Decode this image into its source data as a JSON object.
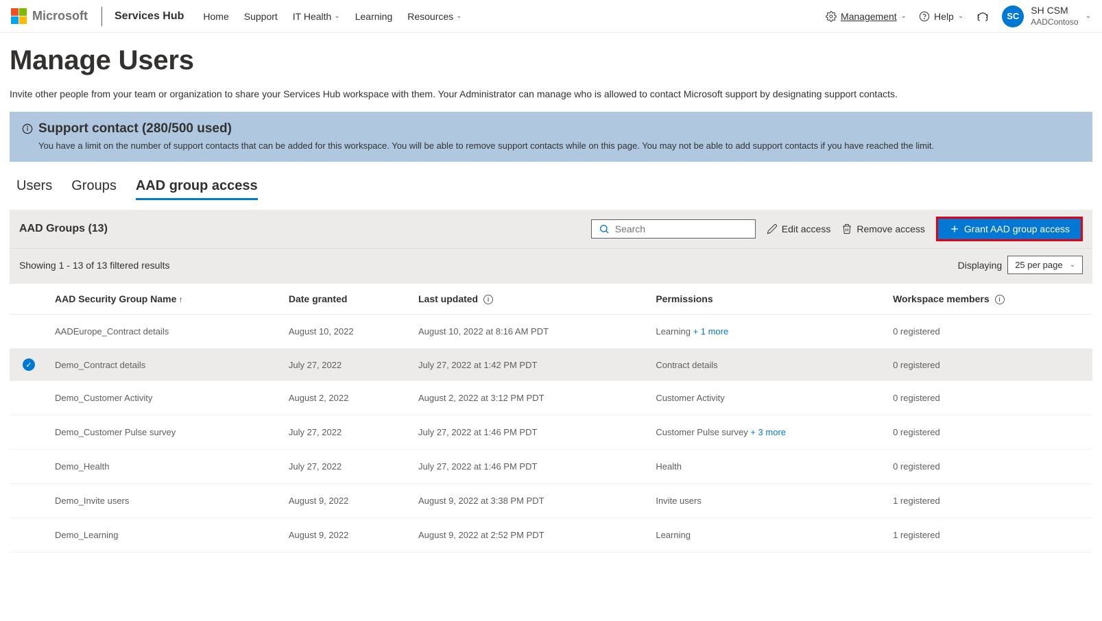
{
  "header": {
    "brand": "Microsoft",
    "app": "Services Hub",
    "nav": {
      "home": "Home",
      "support": "Support",
      "ithealth": "IT Health",
      "learning": "Learning",
      "resources": "Resources"
    },
    "right": {
      "management": "Management",
      "help": "Help"
    },
    "user": {
      "initials": "SC",
      "name": "SH CSM",
      "org": "AADContoso"
    }
  },
  "page": {
    "title": "Manage Users",
    "description": "Invite other people from your team or organization to share your Services Hub workspace with them. Your Administrator can manage who is allowed to contact Microsoft support by designating support contacts."
  },
  "notice": {
    "title": "Support contact (280/500 used)",
    "body": "You have a limit on the number of support contacts that can be added for this workspace. You will be able to remove support contacts while on this page. You may not be able to add support contacts if you have reached the limit."
  },
  "tabs": {
    "users": "Users",
    "groups": "Groups",
    "aad": "AAD group access"
  },
  "toolbar": {
    "title": "AAD Groups (13)",
    "search_placeholder": "Search",
    "edit_access": "Edit access",
    "remove_access": "Remove access",
    "grant_button": "Grant AAD group access"
  },
  "subtoolbar": {
    "showing": "Showing 1 - 13 of 13 filtered results",
    "displaying": "Displaying",
    "page_size": "25 per page"
  },
  "columns": {
    "name": "AAD Security Group Name",
    "date_granted": "Date granted",
    "last_updated": "Last updated",
    "permissions": "Permissions",
    "members": "Workspace members"
  },
  "rows": [
    {
      "selected": false,
      "name": "AADEurope_Contract details",
      "date_granted": "August 10, 2022",
      "last_updated": "August 10, 2022 at 8:16 AM PDT",
      "permissions": "Learning",
      "more": "+ 1 more",
      "members": "0 registered"
    },
    {
      "selected": true,
      "name": "Demo_Contract details",
      "date_granted": "July 27, 2022",
      "last_updated": "July 27, 2022 at 1:42 PM PDT",
      "permissions": "Contract details",
      "more": "",
      "members": "0 registered"
    },
    {
      "selected": false,
      "name": "Demo_Customer Activity",
      "date_granted": "August 2, 2022",
      "last_updated": "August 2, 2022 at 3:12 PM PDT",
      "permissions": "Customer Activity",
      "more": "",
      "members": "0 registered"
    },
    {
      "selected": false,
      "name": "Demo_Customer Pulse survey",
      "date_granted": "July 27, 2022",
      "last_updated": "July 27, 2022 at 1:46 PM PDT",
      "permissions": "Customer Pulse survey",
      "more": "+ 3 more",
      "members": "0 registered"
    },
    {
      "selected": false,
      "name": "Demo_Health",
      "date_granted": "July 27, 2022",
      "last_updated": "July 27, 2022 at 1:46 PM PDT",
      "permissions": "Health",
      "more": "",
      "members": "0 registered"
    },
    {
      "selected": false,
      "name": "Demo_Invite users",
      "date_granted": "August 9, 2022",
      "last_updated": "August 9, 2022 at 3:38 PM PDT",
      "permissions": "Invite users",
      "more": "",
      "members": "1 registered"
    },
    {
      "selected": false,
      "name": "Demo_Learning",
      "date_granted": "August 9, 2022",
      "last_updated": "August 9, 2022 at 2:52 PM PDT",
      "permissions": "Learning",
      "more": "",
      "members": "1 registered"
    }
  ]
}
